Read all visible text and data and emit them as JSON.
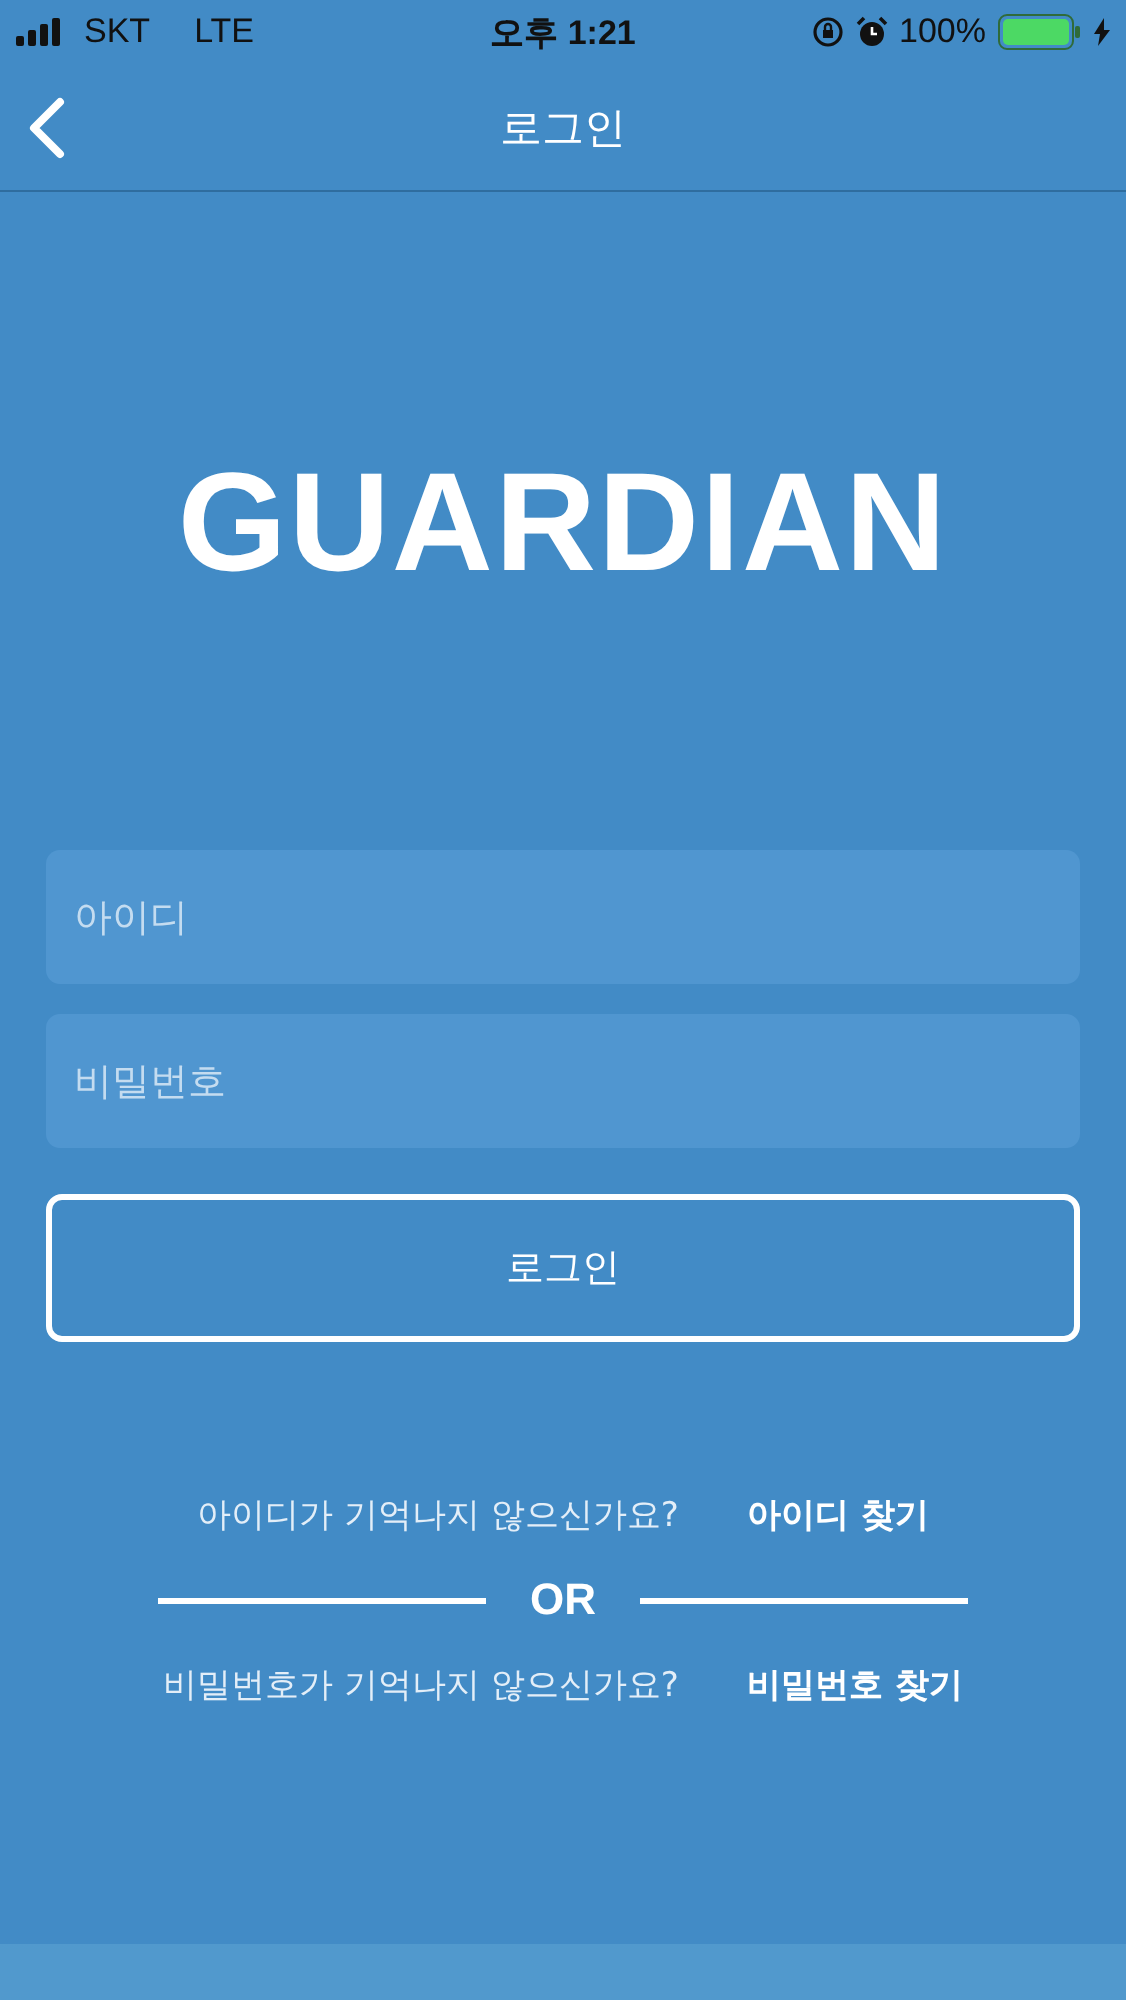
{
  "status_bar": {
    "carrier": "SKT",
    "network": "LTE",
    "time": "오후 1:21",
    "battery": "100%"
  },
  "nav_bar": {
    "title": "로그인"
  },
  "logo": "GUARDIAN",
  "form": {
    "fields": [
      {
        "placeholder": "아이디"
      },
      {
        "placeholder": "비밀번호"
      }
    ],
    "login_button": "로그인"
  },
  "recovery": [
    {
      "question": "아이디가 기억나지 않으신가요?",
      "link": "아이디 찾기"
    },
    {
      "question": "비밀번호가 기억나지 않으신가요?",
      "link": "비밀번호 찾기"
    }
  ],
  "separator": "OR"
}
